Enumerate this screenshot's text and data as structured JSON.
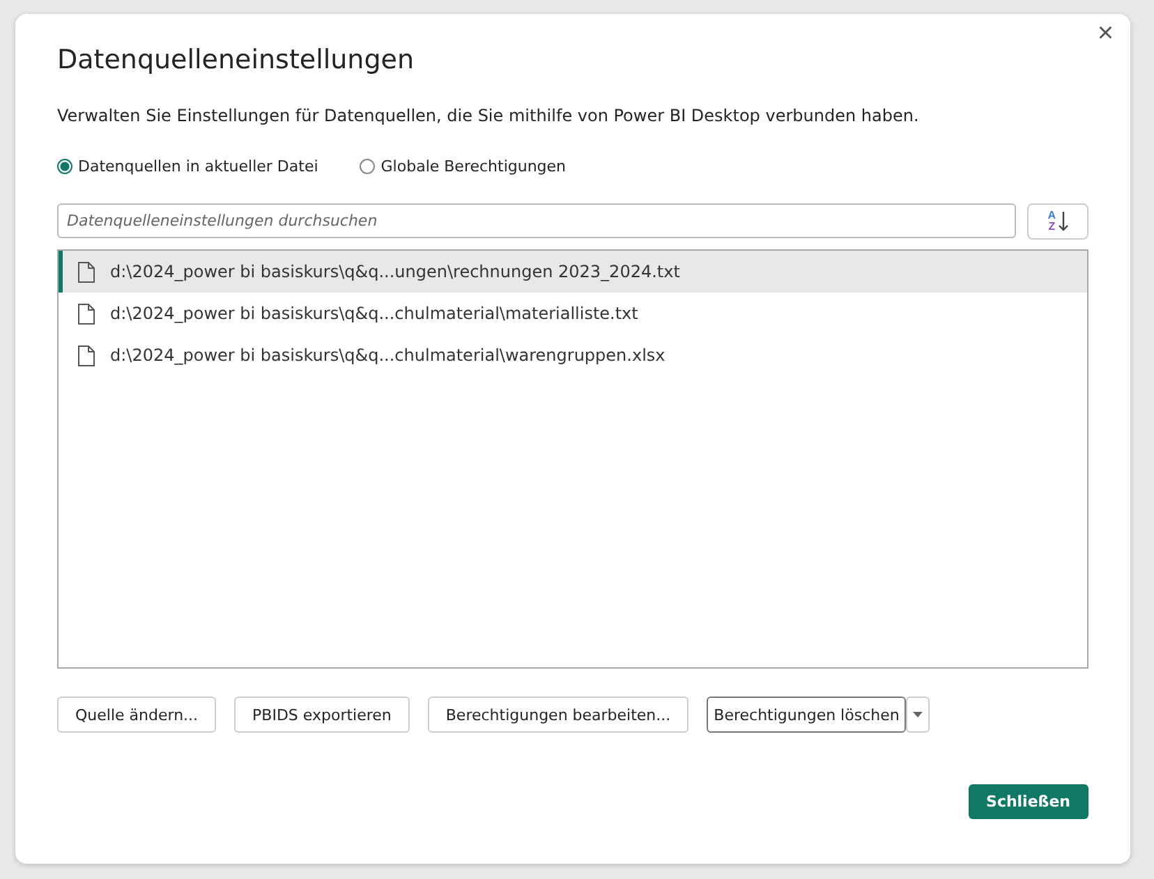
{
  "dialog": {
    "title": "Datenquelleneinstellungen",
    "close": "×",
    "description": "Verwalten Sie Einstellungen für Datenquellen, die Sie mithilfe von Power BI Desktop verbunden haben."
  },
  "scope_options": [
    {
      "label": "Datenquellen in aktueller Datei",
      "selected": true
    },
    {
      "label": "Globale Berechtigungen",
      "selected": false
    }
  ],
  "search": {
    "placeholder": "Datenquelleneinstellungen durchsuchen"
  },
  "sort_button": {
    "top_letter": "A",
    "bottom_letter": "Z"
  },
  "sources": [
    {
      "path": "d:\\2024_power bi basiskurs\\q&q...ungen\\rechnungen 2023_2024.txt",
      "selected": true
    },
    {
      "path": "d:\\2024_power bi basiskurs\\q&q...chulmaterial\\materialliste.txt",
      "selected": false
    },
    {
      "path": "d:\\2024_power bi basiskurs\\q&q...chulmaterial\\warengruppen.xlsx",
      "selected": false
    }
  ],
  "actions": [
    {
      "label": "Quelle ändern...",
      "kind": "plain"
    },
    {
      "label": "PBIDS exportieren",
      "kind": "plain"
    },
    {
      "label": "Berechtigungen bearbeiten...",
      "kind": "plain"
    },
    {
      "label": "Berechtigungen löschen",
      "kind": "split"
    }
  ],
  "close_button": "Schließen"
}
